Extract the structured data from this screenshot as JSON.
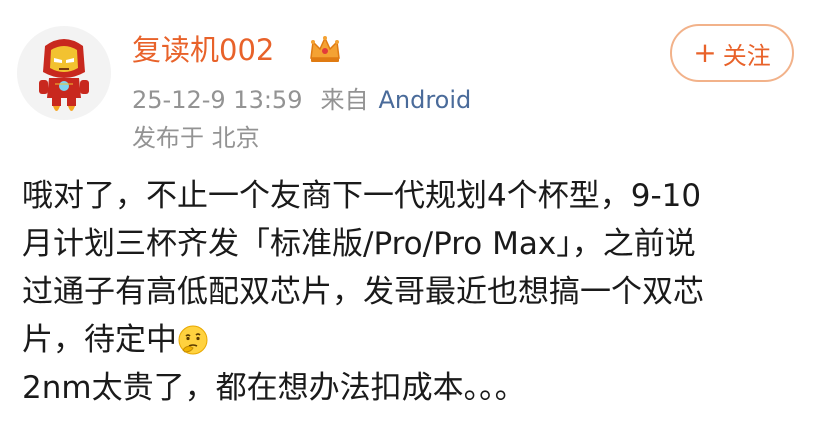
{
  "user": {
    "name": "复读机002",
    "avatar_icon": "iron-man-avatar-icon",
    "badge_icon": "crown-icon"
  },
  "meta": {
    "time": "25-12-9 13:59",
    "source_prefix": "来自",
    "source": "Android",
    "location": "发布于 北京"
  },
  "follow": {
    "plus": "+",
    "label": "关注"
  },
  "post": {
    "lines": [
      "哦对了，不止一个友商下一代规划4个杯型，9-10",
      "月计划三杯齐发「标准版/Pro/Pro Max」，之前说",
      "过通子有高低配双芯片，发哥最近也想搞一个双芯",
      "片，待定中",
      "2nm太贵了，都在想办法扣成本。。。"
    ],
    "emoji_icon": "thinking-face-icon"
  },
  "colors": {
    "username": "#e8622a",
    "follow_border": "#f2b28a",
    "meta": "#939393",
    "source_link": "#4a6b9a"
  }
}
